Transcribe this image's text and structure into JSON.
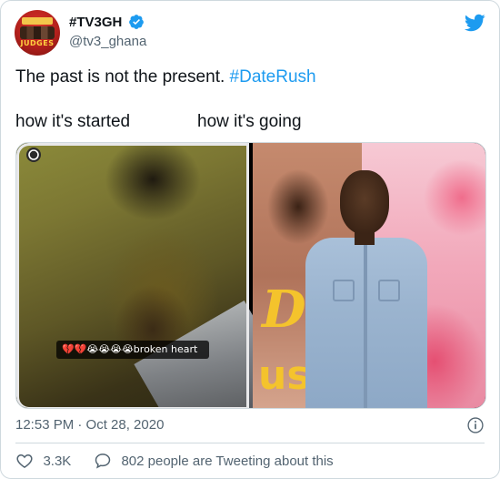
{
  "author": {
    "display_name": "#TV3GH",
    "handle": "@tv3_ghana",
    "avatar_text": "JUDGES",
    "verified": true
  },
  "tweet": {
    "text_prefix": "The past is not the present. ",
    "hashtag": "#DateRush"
  },
  "media": {
    "caption_left": "how it's started",
    "caption_right": "how it's going",
    "left_photo_overlay": "💔💔😭😭😭😭broken heart",
    "right_photo_mural_text_1": "Da",
    "right_photo_mural_text_2": "us"
  },
  "meta": {
    "timestamp": "12:53 PM · Oct 28, 2020"
  },
  "actions": {
    "like_count": "3.3K",
    "conversation_text": "802 people are Tweeting about this"
  },
  "colors": {
    "accent": "#1d9bf0",
    "text_primary": "#0f1419",
    "text_secondary": "#536471",
    "border": "#cfd9de"
  },
  "icons": {
    "verified": "verified-badge-icon",
    "brand": "twitter-bird-icon",
    "info": "info-icon",
    "like": "heart-icon",
    "conversation": "speech-bubble-icon"
  }
}
